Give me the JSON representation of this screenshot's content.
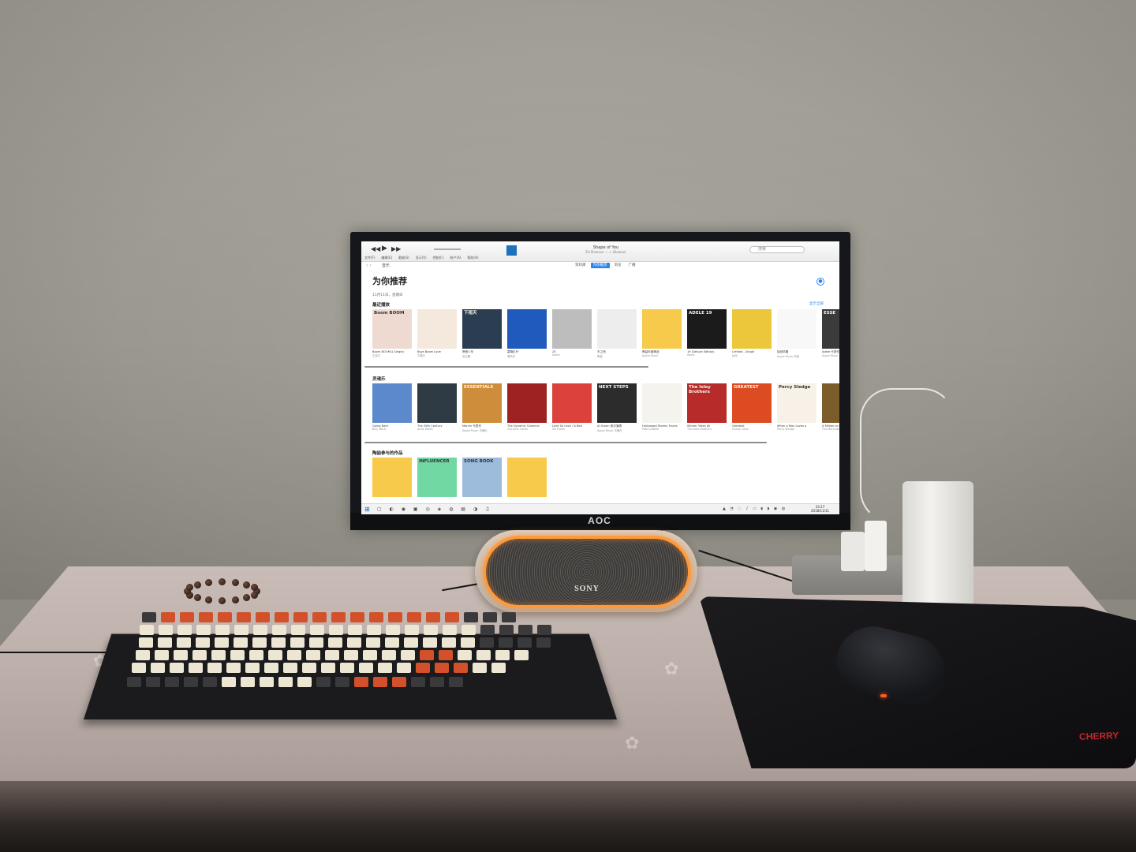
{
  "scene": {
    "monitor_brand": "AOC",
    "speaker_brand": "SONY",
    "mousepad_brand": "CHERRY"
  },
  "itunes": {
    "now_playing_title": "Shape of You",
    "now_playing_detail": "Ed Sheeran — ÷ (Deluxe)",
    "search_placeholder": "搜索",
    "menu": [
      "文件(F)",
      "编辑(E)",
      "歌曲(S)",
      "显示(V)",
      "控制(C)",
      "帐户(A)",
      "帮助(H)"
    ],
    "library_select": "音乐",
    "tabs": [
      {
        "label": "资料库",
        "active": false
      },
      {
        "label": "为你推荐",
        "active": true
      },
      {
        "label": "浏览",
        "active": false
      },
      {
        "label": "广播",
        "active": false
      }
    ],
    "page_title": "为你推荐",
    "subtitle": "11月11日，星期日",
    "see_all": "显示全部",
    "sections": [
      {
        "title": "最近播放",
        "items": [
          {
            "title": "Boom BOOM(1 Single)",
            "artist": "王嘉尔",
            "color": "#e9d6cd",
            "label": "Boom BOOM"
          },
          {
            "title": "Boys Boom Love",
            "artist": "艾薇尔",
            "color": "#f0e3d9",
            "label": ""
          },
          {
            "title": "摩登少年",
            "artist": "岳云鹏",
            "color": "#2a3c4f",
            "label": "下雨天"
          },
          {
            "title": "霜降红叶",
            "artist": "周杰伦",
            "color": "#1f58b8",
            "label": ""
          },
          {
            "title": "25",
            "artist": "Adele",
            "color": "#b9b9b9",
            "label": ""
          },
          {
            "title": "东之西",
            "artist": "陶喆",
            "color": "#e8e8e8",
            "label": ""
          },
          {
            "title": "陶喆年度精选",
            "artist": "Apple Music",
            "color": "#f2c64a",
            "label": ""
          },
          {
            "title": "19 (Deluxe Edition)",
            "artist": "Adele",
            "color": "#1a1a1a",
            "label": "ADELE 19"
          },
          {
            "title": "Limited - Single",
            "artist": "仙乐",
            "color": "#e7c23a",
            "label": ""
          },
          {
            "title": "独领风骚",
            "artist": "Apple Music 嘻哈",
            "color": "#f3f3f3",
            "label": ""
          },
          {
            "title": "Adele 代表作",
            "artist": "Apple Music",
            "color": "#3a3a3a",
            "label": "ESSE"
          }
        ]
      },
      {
        "title": "灵魂乐",
        "items": [
          {
            "title": "Going Back",
            "artist": "Billy Ward",
            "color": "#5a86c8",
            "label": ""
          },
          {
            "title": "The 20th Century",
            "artist": "Andy White",
            "color": "#2d3a44",
            "label": ""
          },
          {
            "title": "Marvin 代表作",
            "artist": "Apple Music 灵魂乐",
            "color": "#c98a3a",
            "label": "ESSENTIALS"
          },
          {
            "title": "The Dynamic Clarence",
            "artist": "Clarence Carter",
            "color": "#9b2121",
            "label": ""
          },
          {
            "title": "Lady So Love / A Bad",
            "artist": "Ike Green",
            "color": "#d8413a",
            "label": ""
          },
          {
            "title": "Al Green 首次演唱",
            "artist": "Apple Music 灵魂乐",
            "color": "#2b2b2b",
            "label": "NEXT STEPS"
          },
          {
            "title": "Hollywood Stories Tracks",
            "artist": "Patti LaBelle",
            "color": "#f0eee8",
            "label": ""
          },
          {
            "title": "Winner Takes All",
            "artist": "The Isley Brothers",
            "color": "#b32a2a",
            "label": "The Isley Brothers"
          },
          {
            "title": "Greatest",
            "artist": "Honey Cone",
            "color": "#d84a21",
            "label": "GREATEST"
          },
          {
            "title": "When a Man Loves a",
            "artist": "Percy Sledge",
            "color": "#f3ece2",
            "label": "Percy Sledge"
          },
          {
            "title": "A Million to One",
            "artist": "The Manhattans",
            "color": "#7a5a2a",
            "label": ""
          }
        ]
      },
      {
        "title": "陶喆参与的作品",
        "items": [
          {
            "title": "",
            "artist": "",
            "color": "#f2c64a",
            "label": ""
          },
          {
            "title": "",
            "artist": "",
            "color": "#6fd3a0",
            "label": "INFLUENCER"
          },
          {
            "title": "",
            "artist": "",
            "color": "#9ab8d8",
            "label": "SONG BOOK"
          },
          {
            "title": "",
            "artist": "",
            "color": "#f2c64a",
            "label": ""
          }
        ]
      }
    ],
    "taskbar_time": "23:17",
    "taskbar_date": "2018/11/11"
  }
}
